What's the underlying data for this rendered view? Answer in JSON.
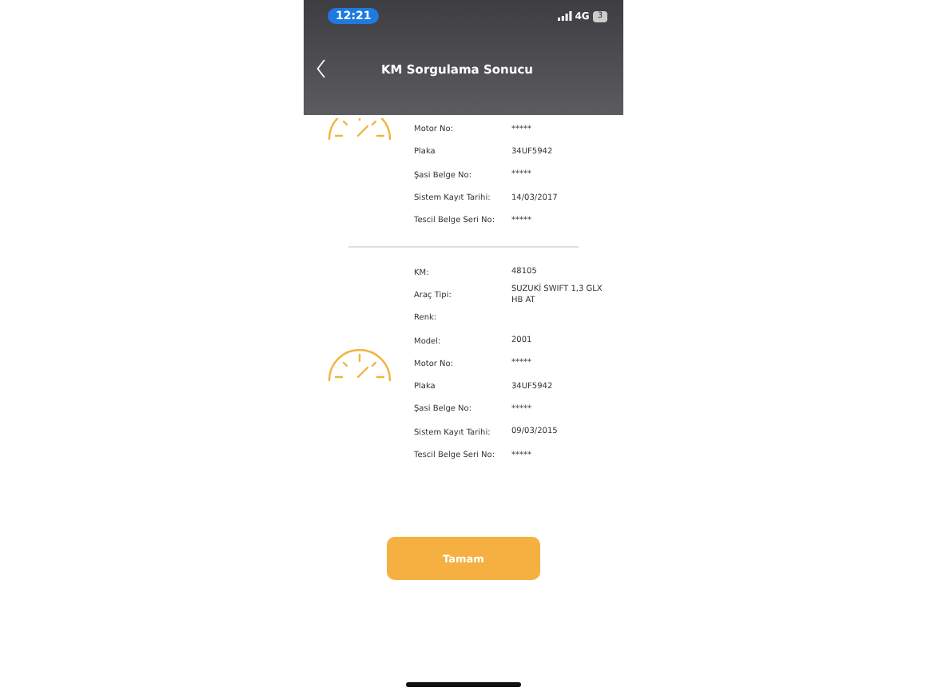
{
  "status_bar": {
    "time": "12:21",
    "network": "4G",
    "battery": "3"
  },
  "header": {
    "title": "KM Sorgulama Sonucu"
  },
  "records": [
    {
      "partially_hidden": true,
      "fields": [
        {
          "label": "Motor No:",
          "value": "*****"
        },
        {
          "label": "Plaka",
          "value": "34UF5942"
        },
        {
          "label": "Şasi Belge No:",
          "value": "*****"
        },
        {
          "label": "Sistem Kayıt Tarihi:",
          "value": "14/03/2017"
        },
        {
          "label": "Tescil Belge Seri No:",
          "value": "*****"
        }
      ]
    },
    {
      "partially_hidden": false,
      "fields": [
        {
          "label": "KM:",
          "value": "48105"
        },
        {
          "label": "Araç Tipi:",
          "value": "SUZUKİ SWIFT 1,3 GLX HB AT"
        },
        {
          "label": "Renk:"
        },
        {
          "label": "Model:",
          "value": "2001"
        },
        {
          "label": "Motor No:",
          "value": "*****"
        },
        {
          "label": "Plaka",
          "value": "34UF5942"
        },
        {
          "label": "Şasi Belge No:",
          "value": "*****"
        },
        {
          "label": "Sistem Kayıt Tarihi:",
          "value": "09/03/2015"
        },
        {
          "label": "Tescil Belge Seri No:",
          "value": "*****"
        }
      ]
    }
  ],
  "button": {
    "label": "Tamam"
  }
}
